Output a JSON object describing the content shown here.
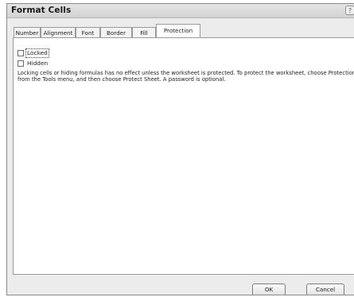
{
  "dialog": {
    "title": "Format Cells",
    "help_symbol": "?"
  },
  "tabs": [
    {
      "label": "Number",
      "active": false
    },
    {
      "label": "Alignment",
      "active": false
    },
    {
      "label": "Font",
      "active": false
    },
    {
      "label": "Border",
      "active": false
    },
    {
      "label": "Fill",
      "active": false
    },
    {
      "label": "Protection",
      "active": true
    }
  ],
  "protection": {
    "locked": {
      "label": "Locked",
      "checked": false
    },
    "hidden": {
      "label": "Hidden",
      "checked": false
    },
    "description": "Locking cells or hiding formulas has no effect unless the worksheet is protected. To protect the worksheet, choose Protection from the Tools menu, and then choose Protect Sheet. A password is optional."
  },
  "buttons": {
    "ok": "OK",
    "cancel": "Cancel"
  }
}
